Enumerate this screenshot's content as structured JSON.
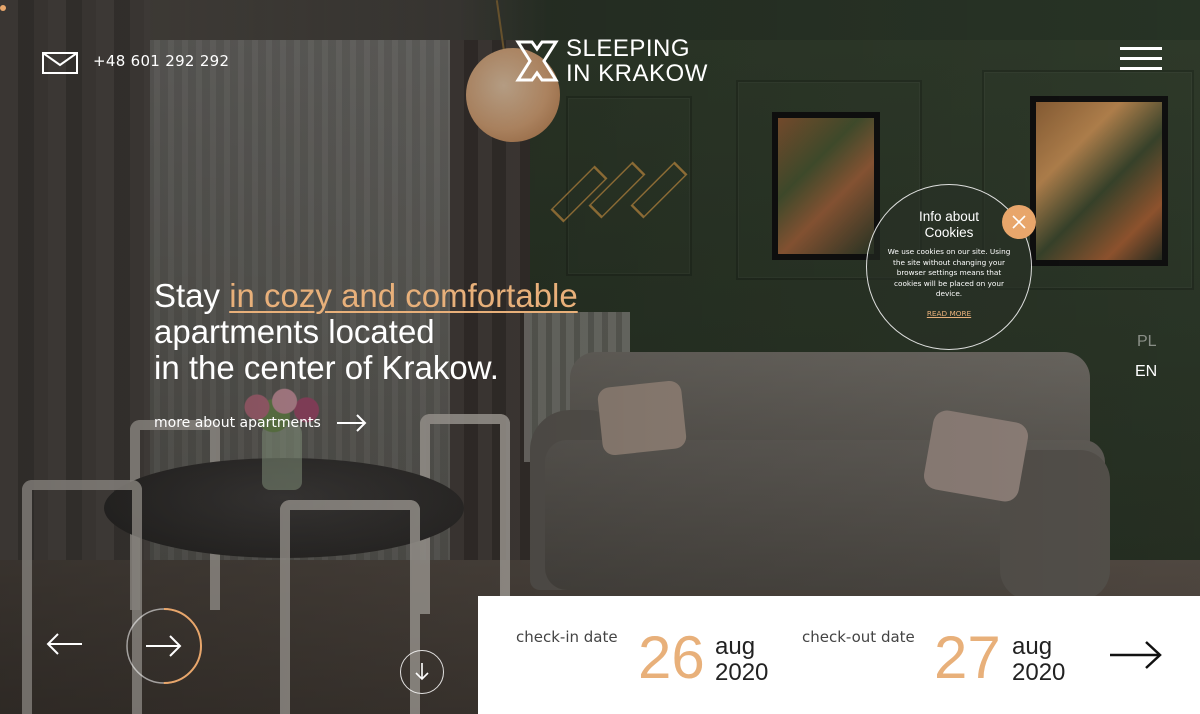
{
  "header": {
    "phone": "+48 601 292 292",
    "logo_line1": "SLEEPING",
    "logo_line2": "IN KRAKOW",
    "mail_icon": "envelope-icon",
    "menu_icon": "hamburger-icon"
  },
  "hero": {
    "line1_prefix": "Stay ",
    "line1_accent": "in cozy and comfortable",
    "line2": "apartments located",
    "line3": "in the center of Krakow.",
    "more_link": "more about apartments"
  },
  "cookie": {
    "title": "Info about Cookies",
    "body": "We use cookies on our site. Using the site without changing your browser settings means that cookies will be placed on your device.",
    "link": "READ MORE",
    "close_icon": "close-icon"
  },
  "languages": [
    {
      "code": "PL",
      "active": false
    },
    {
      "code": "EN",
      "active": true
    }
  ],
  "booking": {
    "checkin": {
      "label": "check-in date",
      "day": "26",
      "month": "aug",
      "year": "2020"
    },
    "checkout": {
      "label": "check-out date",
      "day": "27",
      "month": "aug",
      "year": "2020"
    },
    "submit_icon": "arrow-right-icon"
  },
  "slider": {
    "prev_icon": "arrow-left-icon",
    "next_icon": "arrow-right-icon",
    "progress": 0.5,
    "scroll_icon": "arrow-down-icon"
  },
  "colors": {
    "accent": "#e8b07a",
    "close_button": "#e8a66b",
    "panel_bg": "#ffffff"
  }
}
